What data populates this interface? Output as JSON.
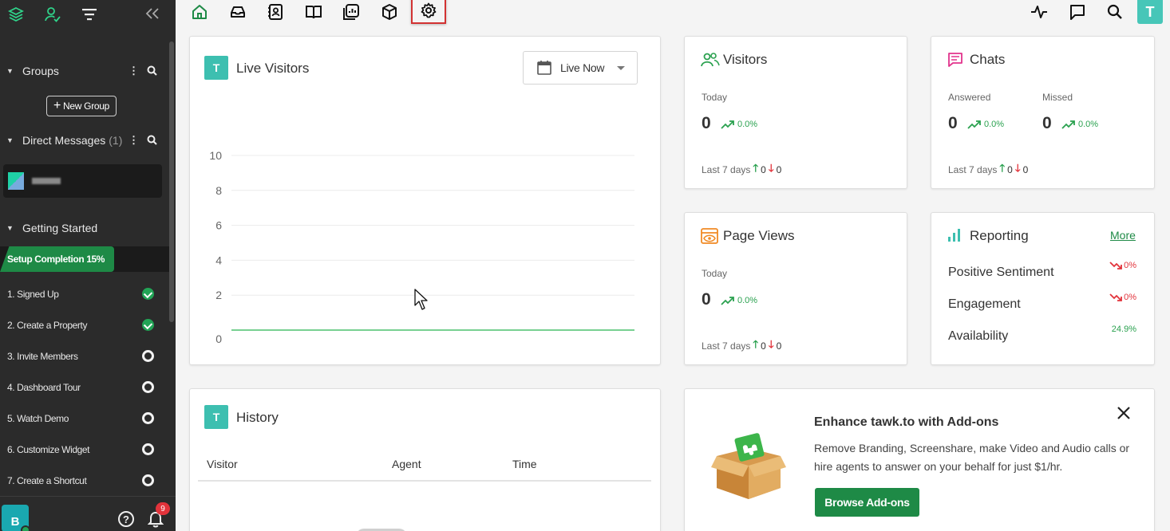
{
  "colors": {
    "sidebar_bg": "#2b2b2b",
    "accent_green": "#1e8a46",
    "teal": "#3dbfb0",
    "trend_up": "#2aa14f",
    "trend_down": "#e2333b",
    "active_outline": "#d23232"
  },
  "sidebar": {
    "top_icons": [
      "layers-icon",
      "agent-icon",
      "filter-icon",
      "collapse-icon"
    ],
    "groups": {
      "label": "Groups",
      "new_group_label": "New Group"
    },
    "direct_messages": {
      "label": "Direct Messages",
      "count": "(1)"
    },
    "getting_started": {
      "label": "Getting Started",
      "setup_completion": "Setup Completion 15%",
      "progress_percent": 15,
      "tasks": [
        {
          "label": "1. Signed Up",
          "done": true
        },
        {
          "label": "2. Create a Property",
          "done": true
        },
        {
          "label": "3. Invite Members",
          "done": false
        },
        {
          "label": "4. Dashboard Tour",
          "done": false
        },
        {
          "label": "5. Watch Demo",
          "done": false
        },
        {
          "label": "6. Customize Widget",
          "done": false
        },
        {
          "label": "7. Create a Shortcut",
          "done": false
        }
      ]
    },
    "user_initial": "B",
    "notification_count": "9"
  },
  "topbar": {
    "nav_icons": [
      "home-icon",
      "inbox-icon",
      "contacts-icon",
      "knowledge-base-icon",
      "reporting-icon",
      "addons-icon",
      "settings-icon"
    ],
    "right_icons": [
      "activity-icon",
      "chat-icon",
      "search-icon"
    ],
    "user_initial": "T"
  },
  "live_visitors": {
    "badge": "T",
    "title": "Live Visitors",
    "filter_label": "Live Now"
  },
  "chart_data": {
    "type": "line",
    "title": "",
    "xlabel": "",
    "ylabel": "",
    "ylim": [
      0,
      10
    ],
    "y_ticks": [
      0,
      2,
      4,
      6,
      8,
      10
    ],
    "grid": true,
    "series": [
      {
        "values": [
          0,
          0,
          0,
          0,
          0,
          0,
          0,
          0,
          0,
          0
        ]
      }
    ]
  },
  "visitors": {
    "title": "Visitors",
    "today_label": "Today",
    "today_value": "0",
    "trend": "0.0%",
    "last7_label": "Last 7 days",
    "up": "0",
    "down": "0"
  },
  "chats": {
    "title": "Chats",
    "answered_label": "Answered",
    "answered_value": "0",
    "answered_trend": "0.0%",
    "missed_label": "Missed",
    "missed_value": "0",
    "missed_trend": "0.0%",
    "last7_label": "Last 7 days",
    "up": "0",
    "down": "0"
  },
  "page_views": {
    "title": "Page Views",
    "today_label": "Today",
    "today_value": "0",
    "trend": "0.0%",
    "last7_label": "Last 7 days",
    "up": "0",
    "down": "0"
  },
  "reporting": {
    "title": "Reporting",
    "more_label": "More",
    "rows": [
      {
        "label": "Positive Sentiment",
        "value": "0%",
        "direction": "down"
      },
      {
        "label": "Engagement",
        "value": "0%",
        "direction": "down"
      },
      {
        "label": "Availability",
        "value": "24.9%",
        "direction": "up"
      }
    ]
  },
  "history": {
    "badge": "T",
    "title": "History",
    "columns": [
      "Visitor",
      "Agent",
      "Time"
    ]
  },
  "addons": {
    "title": "Enhance tawk.to with Add-ons",
    "description": "Remove Branding, Screenshare, make Video and Audio calls or hire agents to answer on your behalf for just $1/hr.",
    "button_label": "Browse Add-ons"
  }
}
